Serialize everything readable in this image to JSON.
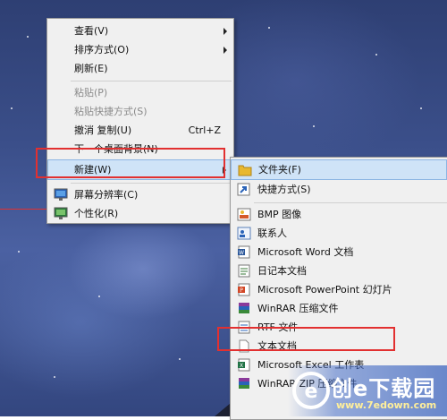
{
  "context_menu": {
    "items": [
      {
        "label": "查看(V)",
        "submenu": true
      },
      {
        "label": "排序方式(O)",
        "submenu": true
      },
      {
        "label": "刷新(E)"
      },
      {
        "label": "粘贴(P)",
        "disabled": true
      },
      {
        "label": "粘贴快捷方式(S)",
        "disabled": true
      },
      {
        "label": "撤消 复制(U)",
        "shortcut": "Ctrl+Z"
      },
      {
        "label": "下一个桌面背景(N)"
      },
      {
        "label": "新建(W)",
        "submenu": true,
        "highlighted": true
      },
      {
        "label": "屏幕分辨率(C)",
        "icon": "display-icon"
      },
      {
        "label": "个性化(R)",
        "icon": "personalize-icon"
      }
    ]
  },
  "new_submenu": {
    "items": [
      {
        "label": "文件夹(F)",
        "icon": "folder-icon",
        "highlighted": true
      },
      {
        "label": "快捷方式(S)",
        "icon": "shortcut-icon"
      },
      {
        "label": "BMP 图像",
        "icon": "bmp-icon"
      },
      {
        "label": "联系人",
        "icon": "contact-icon"
      },
      {
        "label": "Microsoft Word 文档",
        "icon": "word-icon"
      },
      {
        "label": "日记本文档",
        "icon": "journal-icon"
      },
      {
        "label": "Microsoft PowerPoint 幻灯片",
        "icon": "powerpoint-icon"
      },
      {
        "label": "WinRAR 压缩文件",
        "icon": "winrar-icon"
      },
      {
        "label": "RTF 文件",
        "icon": "rtf-icon"
      },
      {
        "label": "文本文档",
        "icon": "text-document-icon"
      },
      {
        "label": "Microsoft Excel 工作表",
        "icon": "excel-icon"
      },
      {
        "label": "WinRAR ZIP 压缩文件",
        "icon": "winrar-zip-icon"
      }
    ]
  },
  "watermark": {
    "brand": "创e下载园",
    "url": "www.7edown.com"
  },
  "colors": {
    "annotation_red": "#e23030",
    "highlight": "#cfe3f7"
  }
}
